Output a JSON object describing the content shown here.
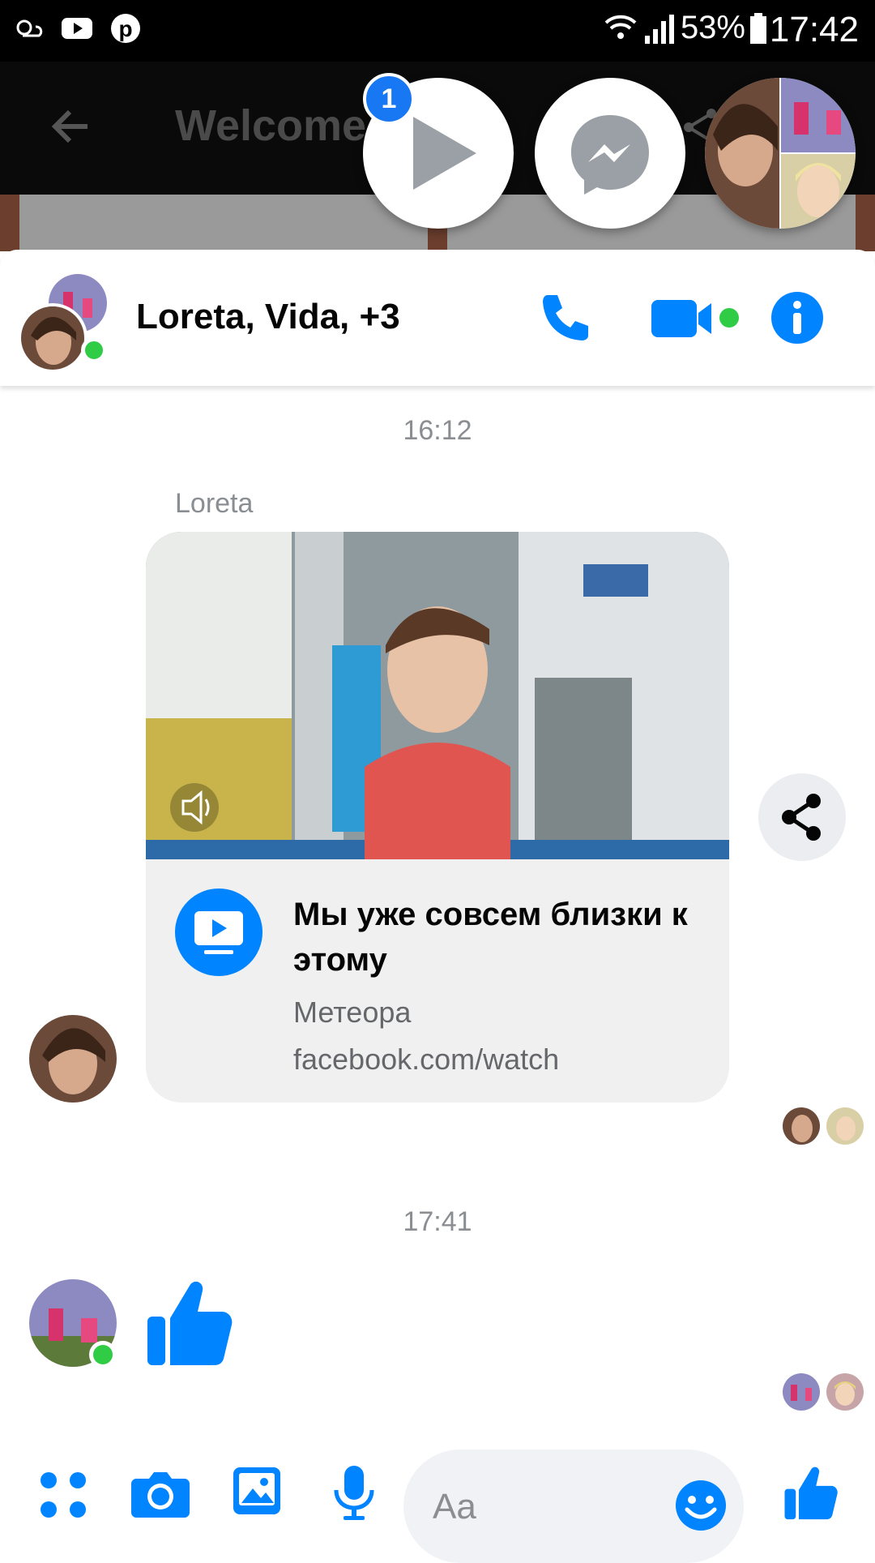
{
  "status_bar": {
    "battery": "53%",
    "time": "17:42"
  },
  "underlying_app": {
    "title": "Welcome"
  },
  "chat_heads": {
    "badge_count": "1"
  },
  "conversation": {
    "title": "Loreta, Vida, +3",
    "messages": [
      {
        "timestamp": "16:12"
      },
      {
        "sender": "Loreta",
        "card": {
          "title": "Мы уже совсем близки к этому",
          "source": "Метеора",
          "link": "facebook.com/watch"
        }
      },
      {
        "timestamp": "17:41"
      }
    ]
  },
  "composer": {
    "placeholder": "Aa"
  },
  "colors": {
    "accent": "#0084ff",
    "online": "#31cc46",
    "bubble": "#f0f0f0"
  }
}
